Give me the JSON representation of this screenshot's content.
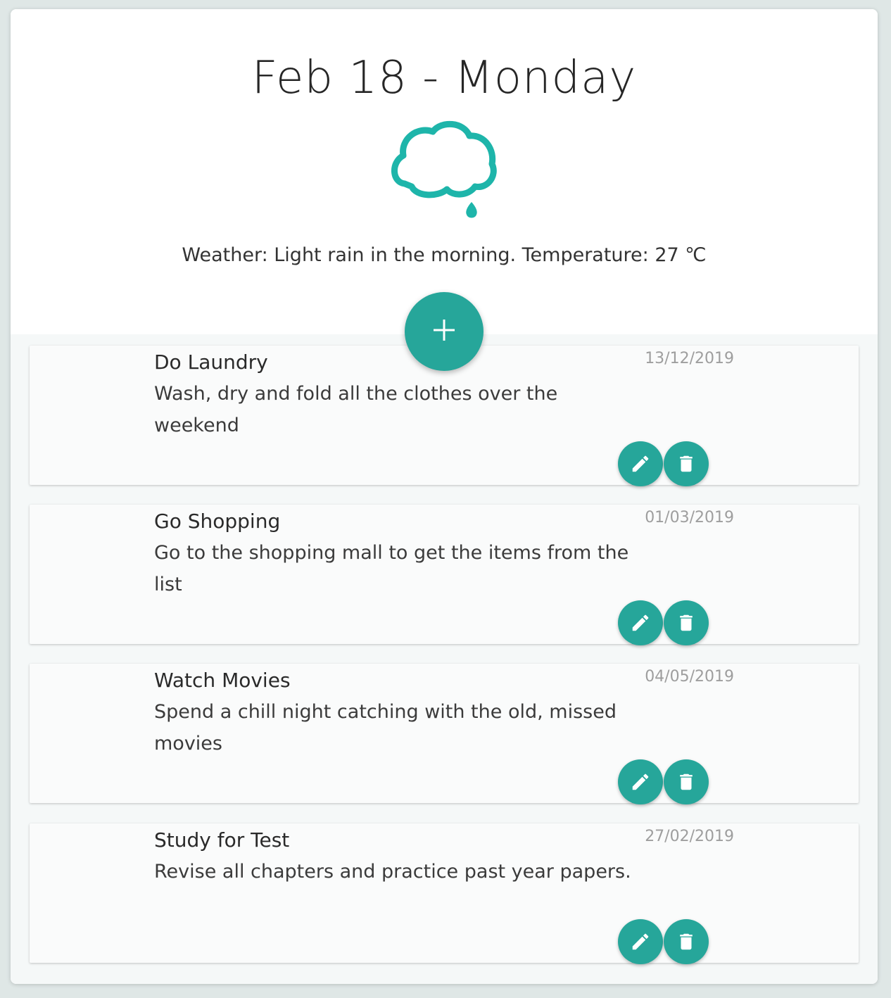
{
  "header": {
    "date_title": "Feb 18 - Monday",
    "weather_icon": "cloud-rain-icon",
    "weather_text": "Weather: Light rain in the morning. Temperature: 27 ℃"
  },
  "actions": {
    "add_label": "+"
  },
  "tasks": [
    {
      "title": "Do Laundry",
      "description": "Wash, dry and fold all the clothes over the weekend",
      "date": "13/12/2019"
    },
    {
      "title": "Go Shopping",
      "description": "Go to the shopping mall to get the items from the list",
      "date": "01/03/2019"
    },
    {
      "title": "Watch Movies",
      "description": "Spend a chill night catching with the old, missed movies",
      "date": "04/05/2019"
    },
    {
      "title": "Study for Test",
      "description": "Revise all chapters and practice past year papers.",
      "date": "27/02/2019"
    }
  ],
  "colors": {
    "accent": "#26a69a",
    "page_bg": "#dfe7e6",
    "card_bg": "#ffffff"
  }
}
